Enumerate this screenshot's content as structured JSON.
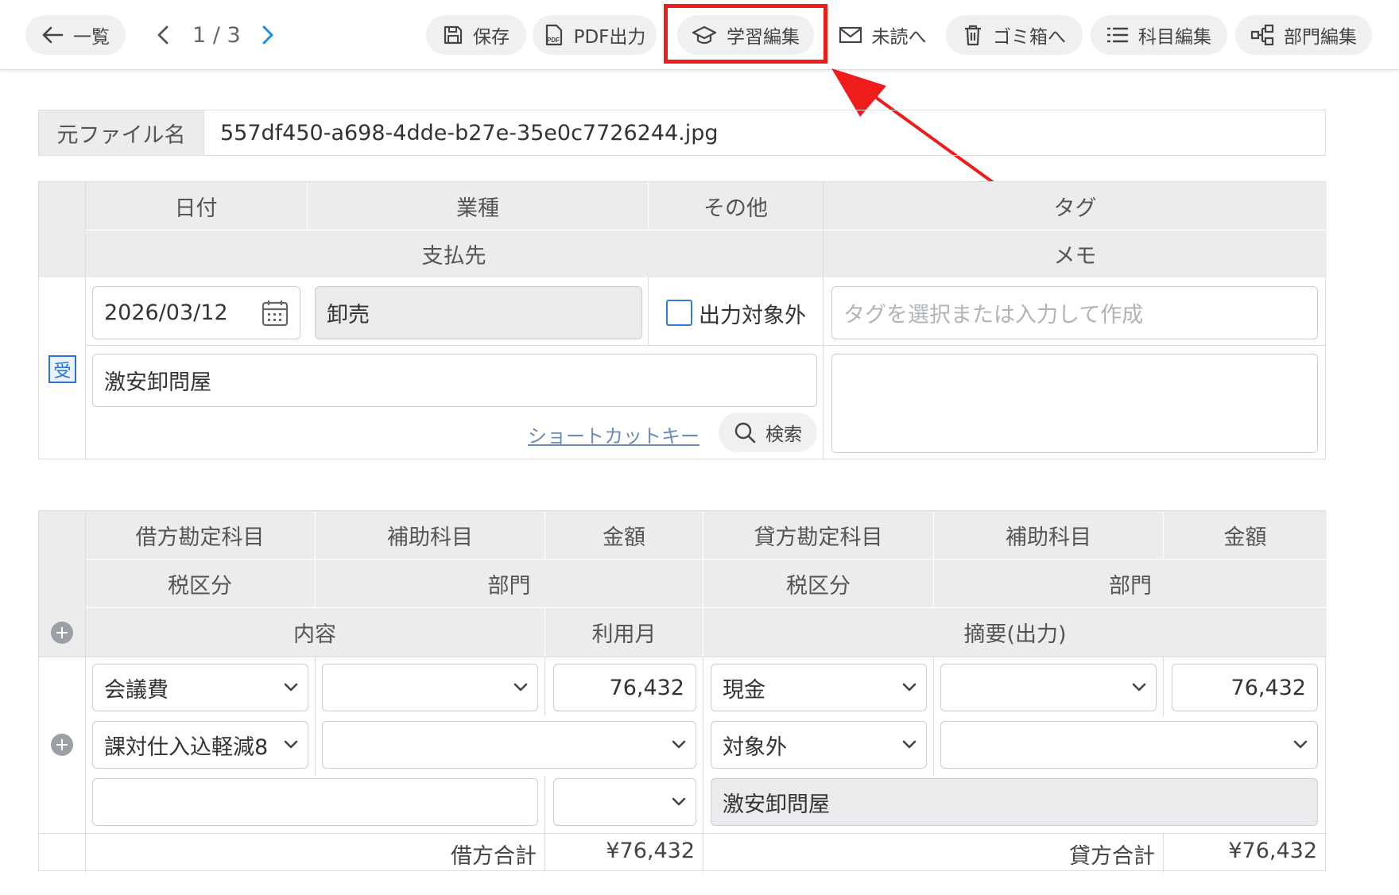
{
  "toolbar": {
    "back_label": "一覧",
    "pager": "1 / 3",
    "buttons": {
      "save": "保存",
      "pdf": "PDF出力",
      "learn": "学習編集",
      "unread": "未読へ",
      "trash": "ゴミ箱へ",
      "accounts": "科目編集",
      "departments": "部門編集"
    },
    "highlight_color": "#ef1c1c"
  },
  "file": {
    "label": "元ファイル名",
    "value": "557df450-a698-4dde-b27e-35e0c7726244.jpg"
  },
  "header": {
    "date_label": "日付",
    "industry_label": "業種",
    "other_label": "その他",
    "tag_label": "タグ",
    "payee_label": "支払先",
    "memo_label": "メモ",
    "date_value": "2026/03/12",
    "industry_value": "卸売",
    "exclude_label": "出力対象外",
    "tag_placeholder": "タグを選択または入力して作成",
    "receipt_badge": "受",
    "payee_value": "激安卸問屋",
    "shortcut_link": "ショートカットキー",
    "search_label": "検索",
    "memo_value": ""
  },
  "journal": {
    "columns": {
      "debit_account": "借方勘定科目",
      "debit_sub": "補助科目",
      "debit_amount": "金額",
      "credit_account": "貸方勘定科目",
      "credit_sub": "補助科目",
      "credit_amount": "金額",
      "debit_tax": "税区分",
      "debit_dept": "部門",
      "credit_tax": "税区分",
      "credit_dept": "部門",
      "content": "内容",
      "usage_month": "利用月",
      "summary": "摘要(出力)"
    },
    "row": {
      "debit_account": "会議費",
      "debit_sub": "",
      "debit_amount": "76,432",
      "credit_account": "現金",
      "credit_sub": "",
      "credit_amount": "76,432",
      "debit_tax": "課対仕入込軽減8",
      "debit_dept": "",
      "credit_tax": "対象外",
      "credit_dept": "",
      "content": "",
      "usage_month": "",
      "summary": "激安卸問屋"
    },
    "totals": {
      "debit_label": "借方合計",
      "debit_value": "¥76,432",
      "credit_label": "貸方合計",
      "credit_value": "¥76,432"
    }
  },
  "icons": [
    "arrow-left-icon",
    "chevron-left-icon",
    "chevron-right-icon",
    "save-icon",
    "pdf-icon",
    "graduation-cap-icon",
    "mail-icon",
    "trash-icon",
    "list-icon",
    "org-chart-icon",
    "calendar-icon",
    "search-icon",
    "chevron-down-icon",
    "plus-circle-icon",
    "annotation-arrow-icon"
  ]
}
